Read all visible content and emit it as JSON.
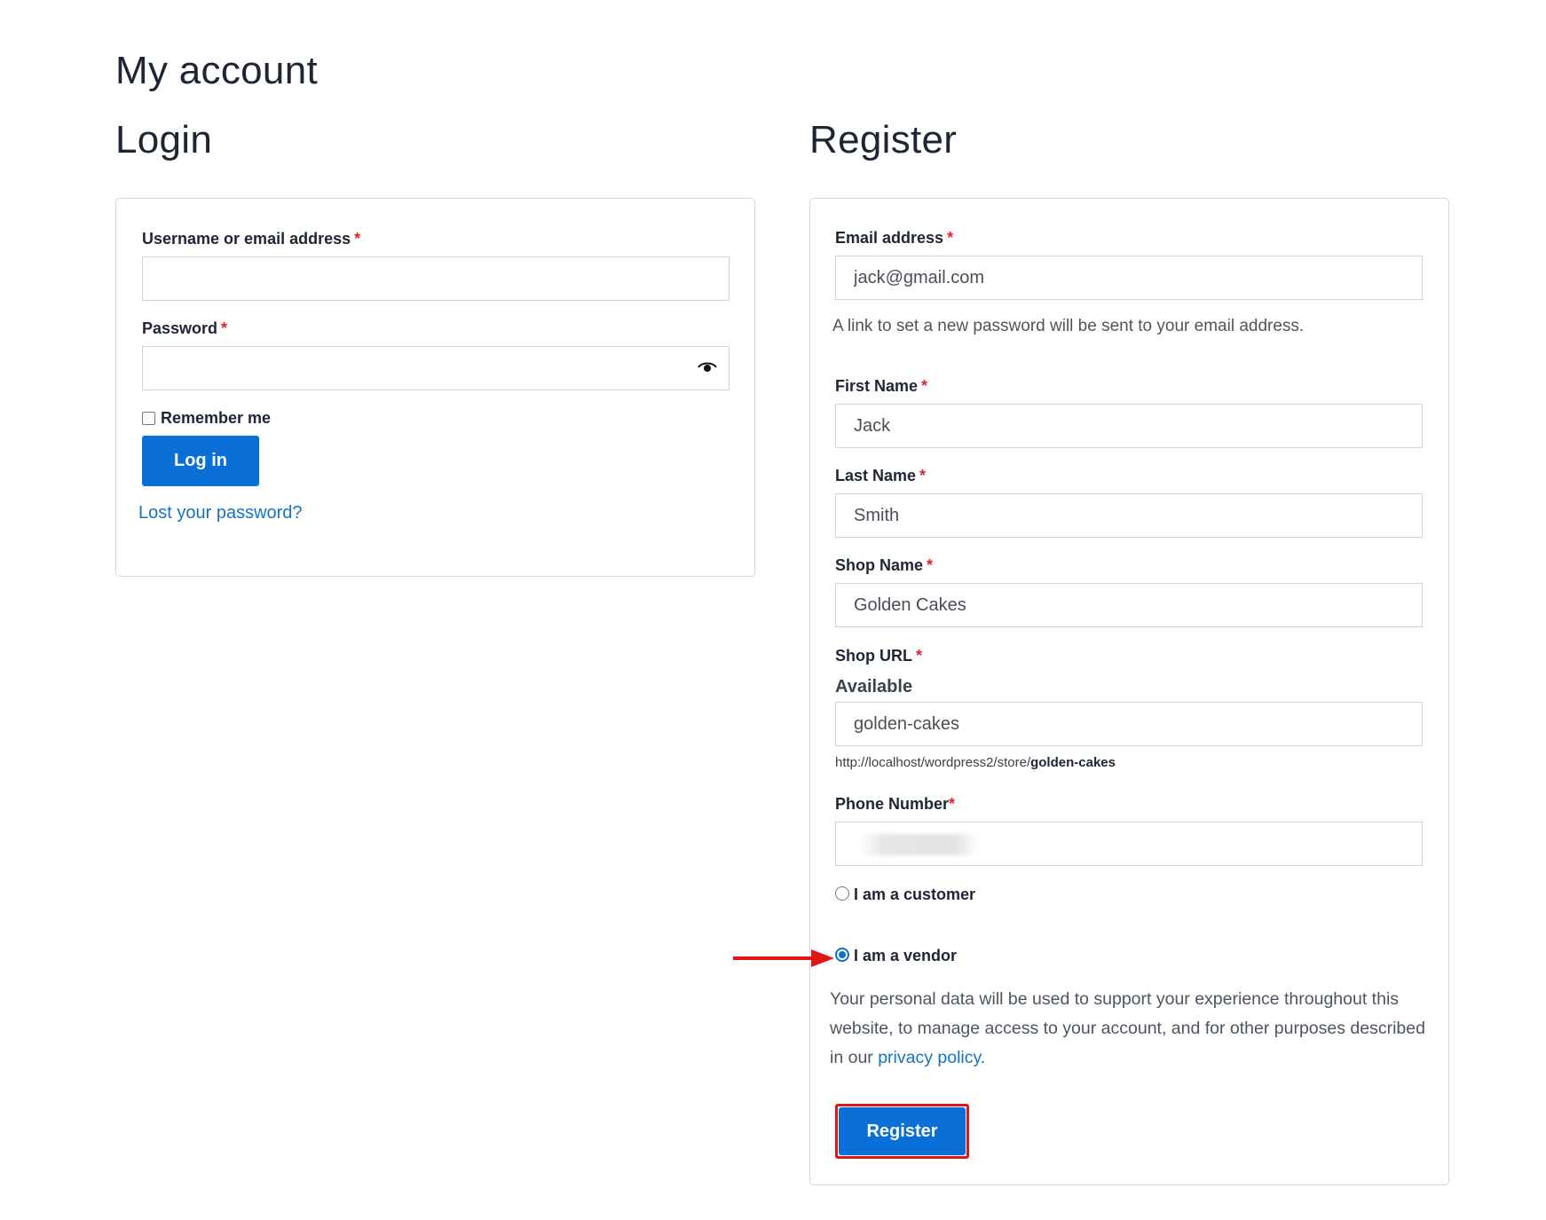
{
  "page": {
    "title": "My account"
  },
  "login": {
    "heading": "Login",
    "username_label": "Username or email address",
    "username_value": "",
    "password_label": "Password",
    "password_value": "",
    "remember_label": "Remember me",
    "remember_checked": false,
    "login_button": "Log in",
    "lost_password_link": "Lost your password?"
  },
  "register": {
    "heading": "Register",
    "email_label": "Email address",
    "email_value": "jack@gmail.com",
    "email_hint": "A link to set a new password will be sent to your email address.",
    "first_name_label": "First Name",
    "first_name_value": "Jack",
    "last_name_label": "Last Name",
    "last_name_value": "Smith",
    "shop_name_label": "Shop Name",
    "shop_name_value": "Golden Cakes",
    "shop_url_label": "Shop URL",
    "shop_url_status": "Available",
    "shop_url_value": "golden-cakes",
    "shop_url_prefix": "http://localhost/wordpress2/store/",
    "shop_url_slug": "golden-cakes",
    "phone_label": "Phone Number",
    "phone_value": "",
    "role_customer_label": "I am a customer",
    "role_vendor_label": "I am a vendor",
    "selected_role": "vendor",
    "privacy_text_before": "Your personal data will be used to support your experience throughout this website, to manage access to your account, and for other purposes described in our ",
    "privacy_link": "privacy policy",
    "privacy_text_after": ".",
    "register_button": "Register"
  },
  "required_marker": "*",
  "colors": {
    "primary_button": "#0a6fd6",
    "link": "#1373c8",
    "required": "#e2222f",
    "annotation": "#e01717"
  },
  "icons": {
    "password_toggle": "eye-icon",
    "annotation_arrow": "arrow-right-icon"
  }
}
